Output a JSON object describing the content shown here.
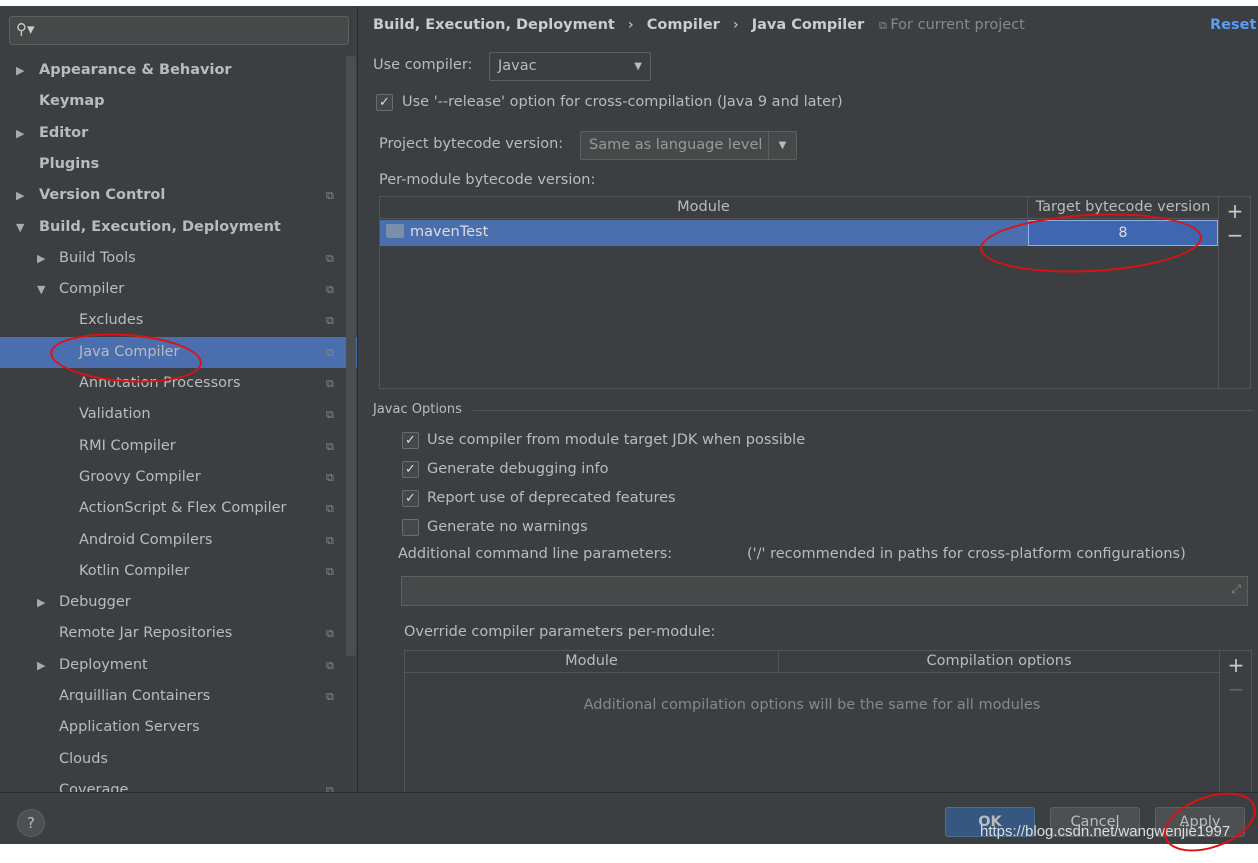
{
  "sidebar": {
    "search_placeholder": "",
    "items": [
      {
        "label": "Appearance & Behavior",
        "arrow": "▶",
        "bold": true
      },
      {
        "label": "Keymap",
        "bold": true
      },
      {
        "label": "Editor",
        "arrow": "▶",
        "bold": true
      },
      {
        "label": "Plugins",
        "bold": true
      },
      {
        "label": "Version Control",
        "arrow": "▶",
        "bold": true,
        "copy": true
      },
      {
        "label": "Build, Execution, Deployment",
        "arrow": "▼",
        "bold": true
      },
      {
        "label": "Build Tools",
        "arrow": "▶",
        "copy": true
      },
      {
        "label": "Compiler",
        "arrow": "▼",
        "copy": true
      },
      {
        "label": "Excludes",
        "copy": true
      },
      {
        "label": "Java Compiler",
        "copy": true,
        "selected": true
      },
      {
        "label": "Annotation Processors",
        "copy": true
      },
      {
        "label": "Validation",
        "copy": true
      },
      {
        "label": "RMI Compiler",
        "copy": true
      },
      {
        "label": "Groovy Compiler",
        "copy": true
      },
      {
        "label": "ActionScript & Flex Compiler",
        "copy": true
      },
      {
        "label": "Android Compilers",
        "copy": true
      },
      {
        "label": "Kotlin Compiler",
        "copy": true
      },
      {
        "label": "Debugger",
        "arrow": "▶"
      },
      {
        "label": "Remote Jar Repositories",
        "copy": true
      },
      {
        "label": "Deployment",
        "arrow": "▶",
        "copy": true
      },
      {
        "label": "Arquillian Containers",
        "copy": true
      },
      {
        "label": "Application Servers"
      },
      {
        "label": "Clouds"
      },
      {
        "label": "Coverage",
        "copy": true
      }
    ]
  },
  "breadcrumb": {
    "b1": "Build, Execution, Deployment",
    "b2": "Compiler",
    "b3": "Java Compiler",
    "sep": "›",
    "scope": "For current project",
    "reset": "Reset"
  },
  "compiler": {
    "label": "Use compiler:",
    "value": "Javac"
  },
  "release": {
    "label": "Use '--release' option for cross-compilation (Java 9 and later)",
    "checked": true
  },
  "bytecode": {
    "label": "Project bytecode version:",
    "value": "Same as language level"
  },
  "per_module": {
    "label": "Per-module bytecode version:",
    "col_module": "Module",
    "col_target": "Target bytecode version",
    "rows": [
      {
        "module": "mavenTest",
        "target": "8"
      }
    ]
  },
  "javac": {
    "title": "Javac Options",
    "options": [
      {
        "label": "Use compiler from module target JDK when possible",
        "checked": true
      },
      {
        "label": "Generate debugging info",
        "checked": true
      },
      {
        "label": "Report use of deprecated features",
        "checked": true
      },
      {
        "label": "Generate no warnings",
        "checked": false
      }
    ],
    "params_label": "Additional command line parameters:",
    "params_hint": "('/' recommended in paths for cross-platform configurations)",
    "params_value": "",
    "override_label": "Override compiler parameters per-module:",
    "col_module": "Module",
    "col_options": "Compilation options",
    "empty": "Additional compilation options will be the same for all modules"
  },
  "footer": {
    "help": "?",
    "ok": "OK",
    "cancel": "Cancel",
    "apply": "Apply",
    "watermark": "https://blog.csdn.net/wangwenjie1997"
  },
  "colors": {
    "selection": "#4b6eaf",
    "annotation": "#e01010"
  }
}
